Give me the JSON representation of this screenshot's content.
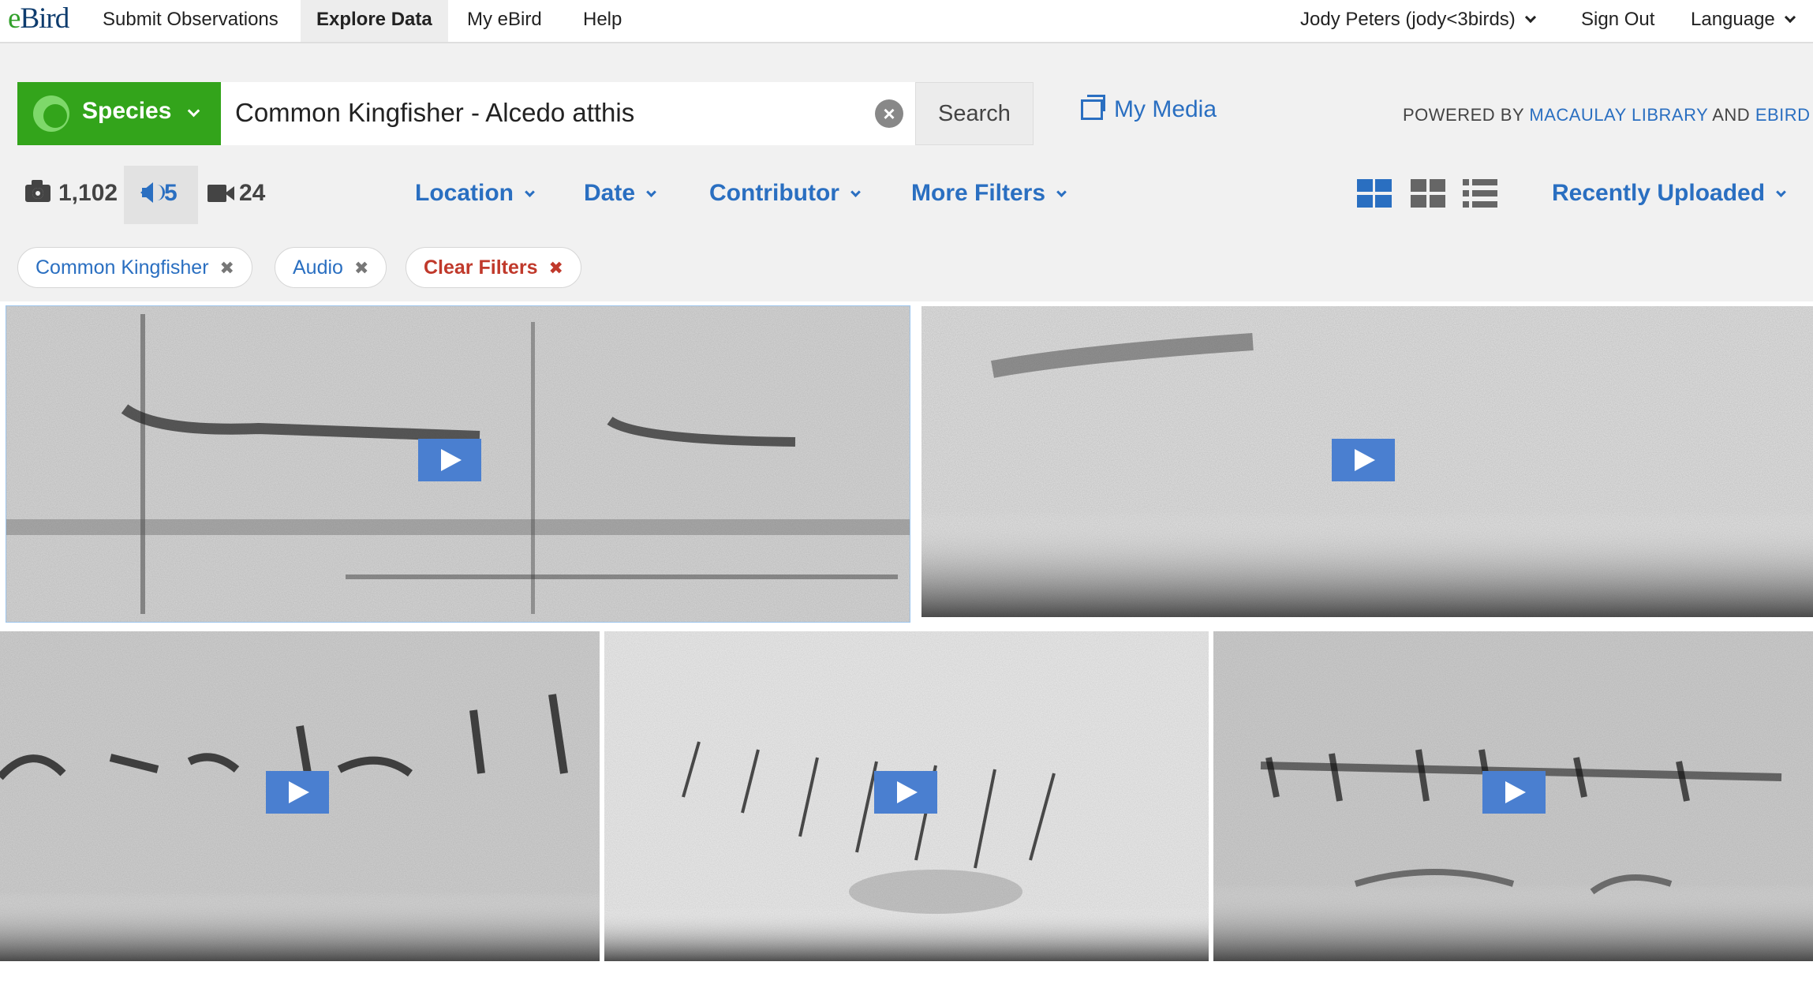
{
  "nav": {
    "logo": "eBird",
    "items": [
      "Submit Observations",
      "Explore Data",
      "My eBird",
      "Help"
    ],
    "active": "Explore Data",
    "user": "Jody Peters (jody<3birds)",
    "sign_out": "Sign Out",
    "language": "Language"
  },
  "search": {
    "type_label": "Species",
    "query": "Common Kingfisher - Alcedo atthis",
    "button": "Search",
    "my_media": "My Media",
    "powered_prefix": "POWERED BY",
    "powered_link1": "MACAULAY LIBRARY",
    "powered_and": "AND",
    "powered_link2": "EBIRD"
  },
  "counts": {
    "photos": "1,102",
    "audio": "5",
    "video": "24"
  },
  "filters": {
    "location": "Location",
    "date": "Date",
    "contributor": "Contributor",
    "more": "More Filters",
    "sort": "Recently Uploaded"
  },
  "chips": [
    {
      "label": "Common Kingfisher"
    },
    {
      "label": "Audio"
    },
    {
      "label": "Clear Filters"
    }
  ],
  "colors": {
    "accent": "#2a6fc1",
    "species_green": "#33a41b",
    "clear_red": "#c0392b",
    "play_button": "#4a7fd0"
  },
  "icons": [
    "camera-icon",
    "speaker-icon",
    "video-icon",
    "grid-view-icon",
    "small-grid-view-icon",
    "list-view-icon",
    "play-icon",
    "close-icon",
    "chevron-down-icon"
  ],
  "media": {
    "count_shown": 5,
    "type": "audio spectrogram"
  }
}
